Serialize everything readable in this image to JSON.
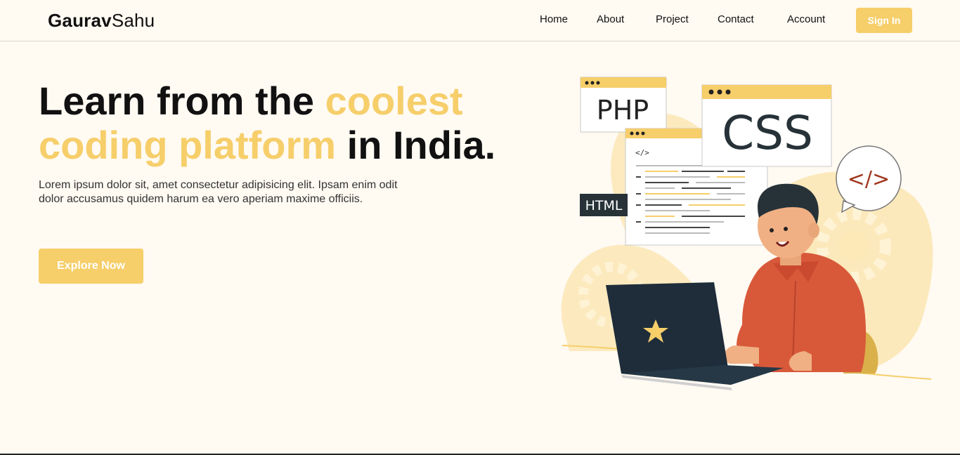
{
  "brand": {
    "first": "Gaurav",
    "second": "Sahu"
  },
  "nav": {
    "items": [
      "Home",
      "About",
      "Project",
      "Contact",
      "Account"
    ],
    "signin_label": "Sign In"
  },
  "hero": {
    "headline_part1": "Learn from the ",
    "headline_accent1": "coolest",
    "headline_accent2": "coding platform",
    "headline_part2": " in India.",
    "description": "Lorem ipsum dolor sit, amet consectetur adipisicing elit. Ipsam enim odit dolor accusamus quidem harum ea vero aperiam maxime officiis.",
    "cta_label": "Explore Now"
  },
  "illustration": {
    "php_label": "PHP",
    "css_label": "CSS",
    "html_label": "HTML",
    "code_tag": "</>",
    "bubble_tag": "</>"
  },
  "colors": {
    "accent": "#f6ce6a",
    "background": "#fffaf2",
    "shirt": "#d8593a",
    "laptop": "#1f2d3a"
  }
}
